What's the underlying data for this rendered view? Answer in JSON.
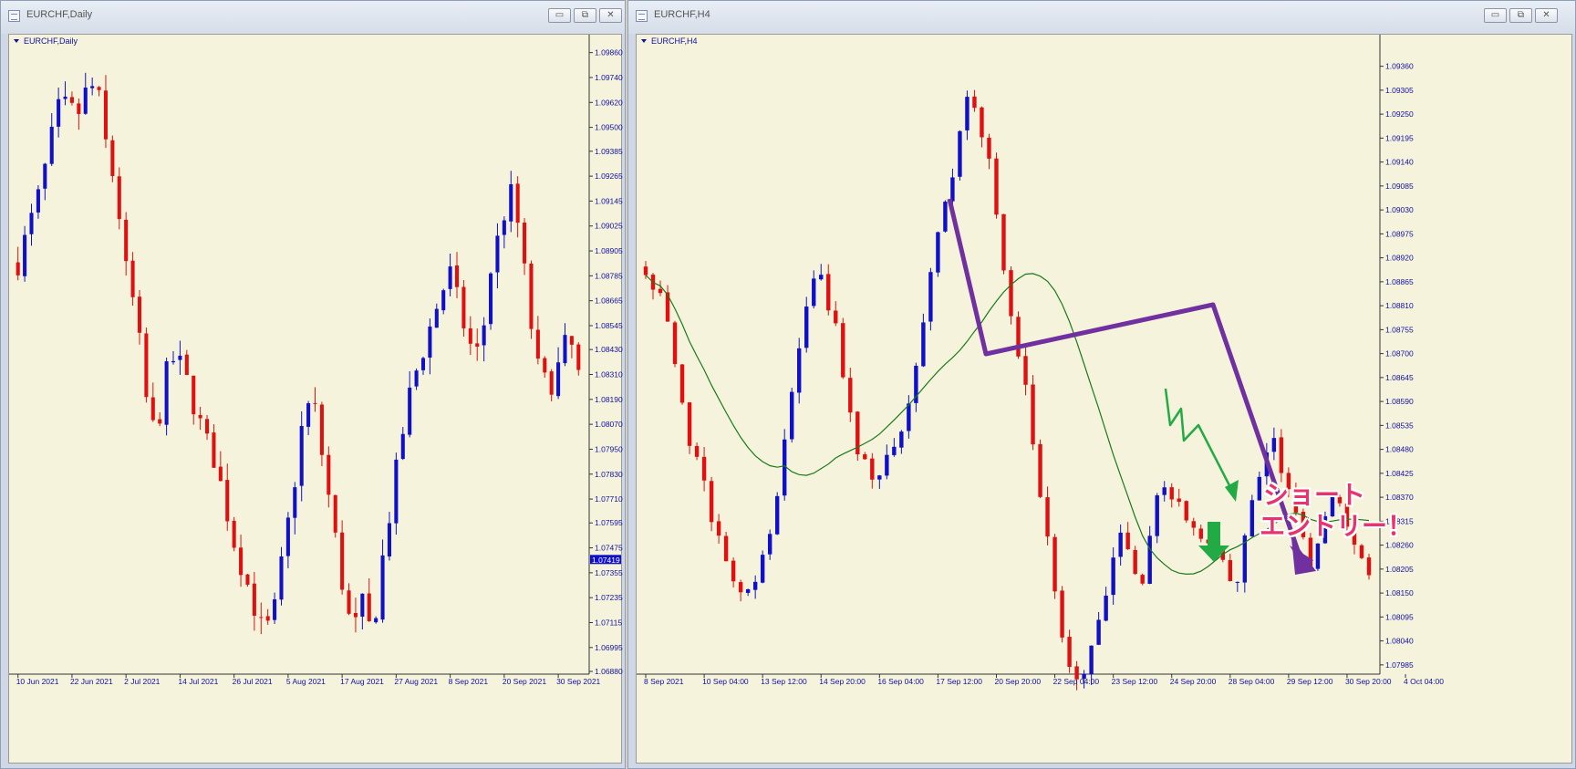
{
  "left_window": {
    "title": "EURCHF,Daily",
    "chart_label": "EURCHF,Daily",
    "current_price_label": "1.07419"
  },
  "right_window": {
    "title": "EURCHF,H4",
    "chart_label": "EURCHF,H4"
  },
  "window_buttons": {
    "minimize": "▭",
    "restore": "⧉",
    "close": "✕"
  },
  "annotation": {
    "line1": "ショート",
    "line2": "エントリー！"
  },
  "colors": {
    "background": "#f5f3dc",
    "bull": "#1010c8",
    "bear": "#e01010",
    "ma": "#1a7a1a",
    "trend_arrow": "#7030a0",
    "green_arrow": "#22aa44",
    "annotation_text": "#e8336d",
    "axis_text": "#1010a0"
  },
  "chart_data": [
    {
      "type": "candlestick",
      "symbol_timeframe": "EURCHF,Daily",
      "ylim": [
        1.0688,
        1.0992
      ],
      "y_ticks": [
        "1.09860",
        "1.09740",
        "1.09620",
        "1.09500",
        "1.09385",
        "1.09265",
        "1.09145",
        "1.09025",
        "1.08905",
        "1.08785",
        "1.08665",
        "1.08545",
        "1.08430",
        "1.08310",
        "1.08190",
        "1.08070",
        "1.07950",
        "1.07830",
        "1.07710",
        "1.07595",
        "1.07475",
        "1.07355",
        "1.07235",
        "1.07115",
        "1.06995",
        "1.06880"
      ],
      "x_ticks": [
        {
          "label": "10 Jun 2021",
          "index": 0
        },
        {
          "label": "22 Jun 2021",
          "index": 8
        },
        {
          "label": "2 Jul 2021",
          "index": 16
        },
        {
          "label": "14 Jul 2021",
          "index": 24
        },
        {
          "label": "26 Jul 2021",
          "index": 32
        },
        {
          "label": "5 Aug 2021",
          "index": 40
        },
        {
          "label": "17 Aug 2021",
          "index": 48
        },
        {
          "label": "27 Aug 2021",
          "index": 56
        },
        {
          "label": "8 Sep 2021",
          "index": 64
        },
        {
          "label": "20 Sep 2021",
          "index": 72
        },
        {
          "label": "30 Sep 2021",
          "index": 80
        }
      ],
      "current_price": 1.07419,
      "anchors": [
        1.0885,
        1.09,
        1.0915,
        1.0935,
        1.0958,
        1.096,
        1.0955,
        1.0968,
        1.097,
        1.094,
        1.092,
        1.088,
        1.086,
        1.082,
        1.08,
        1.083,
        1.084,
        1.083,
        1.0815,
        1.08,
        1.079,
        1.077,
        1.075,
        1.0735,
        1.072,
        1.0705,
        1.0715,
        1.0745,
        1.0775,
        1.081,
        1.082,
        1.079,
        1.076,
        1.073,
        1.0705,
        1.072,
        1.0705,
        1.074,
        1.077,
        1.08,
        1.0825,
        1.084,
        1.0855,
        1.087,
        1.088,
        1.086,
        1.0845,
        1.084,
        1.088,
        1.09,
        1.092,
        1.09,
        1.086,
        1.083,
        1.0825,
        1.0835,
        1.085,
        1.083
      ],
      "candle_count": 84
    },
    {
      "type": "candlestick",
      "symbol_timeframe": "EURCHF,H4",
      "ylim": [
        1.0797,
        1.0942
      ],
      "y_ticks": [
        "1.09360",
        "1.09305",
        "1.09250",
        "1.09195",
        "1.09140",
        "1.09085",
        "1.09030",
        "1.08975",
        "1.08920",
        "1.08865",
        "1.08810",
        "1.08755",
        "1.08700",
        "1.08645",
        "1.08590",
        "1.08535",
        "1.08480",
        "1.08425",
        "1.08370",
        "1.08315",
        "1.08260",
        "1.08205",
        "1.08150",
        "1.08095",
        "1.08040",
        "1.07985"
      ],
      "x_ticks": [
        {
          "label": "8 Sep 2021",
          "index": 0
        },
        {
          "label": "10 Sep 04:00",
          "index": 8
        },
        {
          "label": "13 Sep 12:00",
          "index": 16
        },
        {
          "label": "14 Sep 20:00",
          "index": 24
        },
        {
          "label": "16 Sep 04:00",
          "index": 32
        },
        {
          "label": "17 Sep 12:00",
          "index": 40
        },
        {
          "label": "20 Sep 20:00",
          "index": 48
        },
        {
          "label": "22 Sep 04:00",
          "index": 56
        },
        {
          "label": "23 Sep 12:00",
          "index": 64
        },
        {
          "label": "24 Sep 20:00",
          "index": 72
        },
        {
          "label": "28 Sep 04:00",
          "index": 80
        },
        {
          "label": "29 Sep 12:00",
          "index": 88
        },
        {
          "label": "30 Sep 20:00",
          "index": 96
        },
        {
          "label": "4 Oct 04:00",
          "index": 104
        }
      ],
      "anchors": [
        1.089,
        1.088,
        1.0855,
        1.084,
        1.0825,
        1.0815,
        1.082,
        1.084,
        1.087,
        1.089,
        1.0875,
        1.085,
        1.084,
        1.0848,
        1.086,
        1.089,
        1.091,
        1.093,
        1.0915,
        1.0885,
        1.086,
        1.083,
        1.08,
        1.0795,
        1.081,
        1.083,
        1.0815,
        1.084,
        1.0835,
        1.083,
        1.0825,
        1.0815,
        1.084,
        1.085,
        1.0835,
        1.082,
        1.0838,
        1.083,
        1.082
      ],
      "candle_count": 100
    }
  ]
}
